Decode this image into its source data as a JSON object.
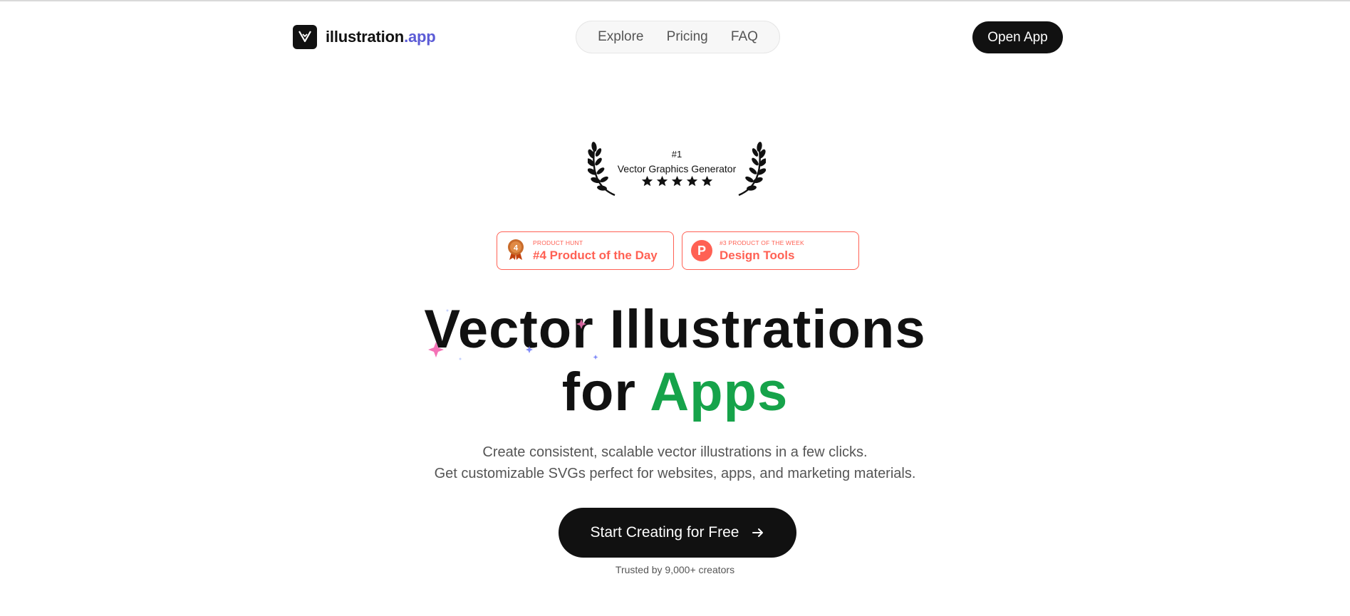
{
  "header": {
    "logo_text": "illustration",
    "logo_accent": ".app",
    "nav": [
      "Explore",
      "Pricing",
      "FAQ"
    ],
    "open_app_label": "Open App"
  },
  "award": {
    "rank": "#1",
    "title": "Vector Graphics Generator",
    "stars": 5
  },
  "badges": [
    {
      "small": "PRODUCT HUNT",
      "big": "#4 Product of the Day",
      "icon": "medal-icon",
      "icon_text": "4"
    },
    {
      "small": "#3 PRODUCT OF THE WEEK",
      "big": "Design Tools",
      "icon": "producthunt-icon",
      "icon_text": "P"
    }
  ],
  "hero": {
    "line1": "Vector Illustrations",
    "line2_prefix": "for ",
    "line2_accent": "Apps",
    "accent_color": "#16a34a"
  },
  "subtitle": {
    "line1": "Create consistent, scalable vector illustrations in a few clicks.",
    "line2": "Get customizable SVGs perfect for websites, apps, and marketing materials."
  },
  "cta": {
    "label": "Start Creating for Free",
    "icon": "arrow-right-icon"
  },
  "trusted": "Trusted by 9,000+ creators",
  "colors": {
    "brand_accent": "#5b5bd6",
    "product_hunt": "#ff6154",
    "dark": "#111111"
  }
}
